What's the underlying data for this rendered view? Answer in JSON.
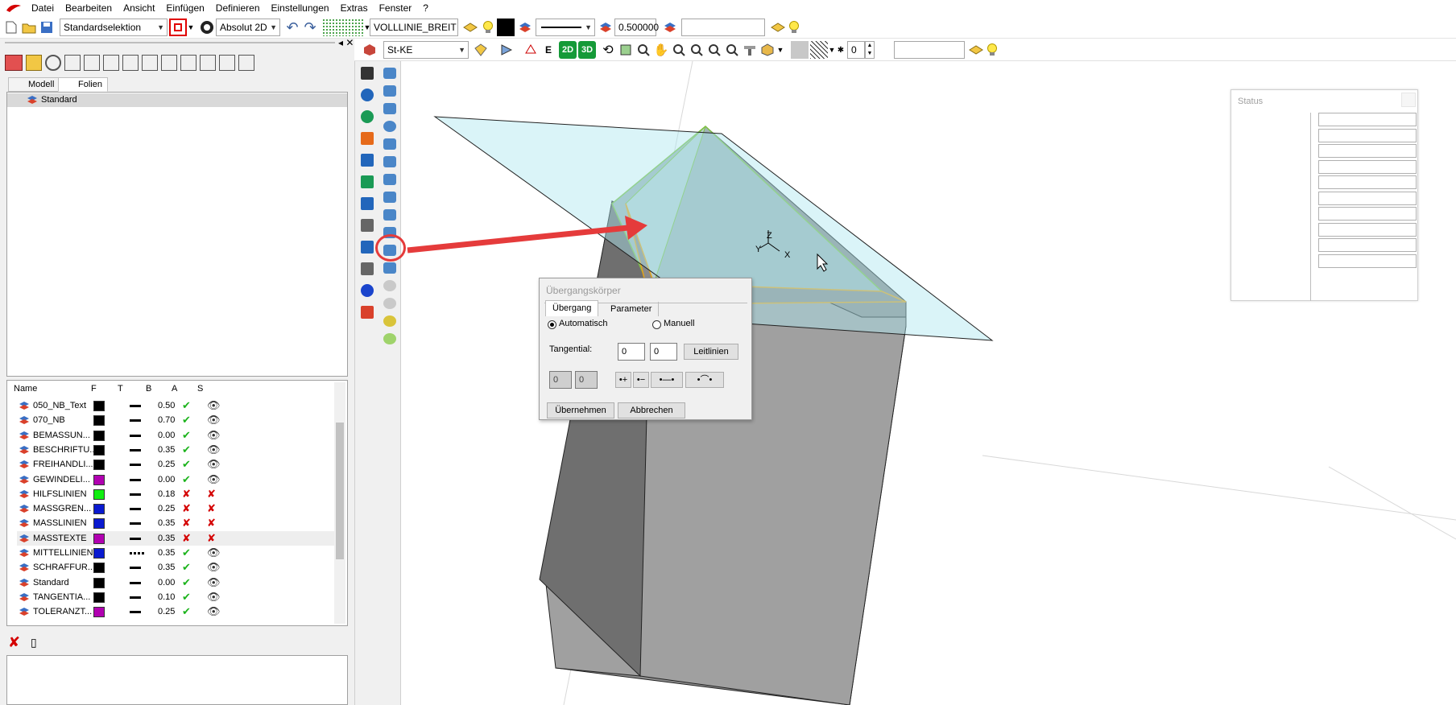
{
  "menu": [
    "Datei",
    "Bearbeiten",
    "Ansicht",
    "Einfügen",
    "Definieren",
    "Einstellungen",
    "Extras",
    "Fenster",
    "?"
  ],
  "toolbar1": {
    "selection_combo": "Standardselektion",
    "view_combo": "Absolut 2D",
    "linetype_field": "VOLLLINIE_BREIT",
    "width_field": "0.500000",
    "colors": {
      "red": "#e00000",
      "black": "#000000"
    }
  },
  "toolbar2": {
    "material_combo": "St-KE",
    "btn_2d": "2D",
    "btn_3d": "3D",
    "spin_value": "0"
  },
  "left": {
    "tabs": {
      "modell": "Modell",
      "folien": "Folien"
    },
    "tree_item": "Standard",
    "headers": {
      "name": "Name",
      "f": "F",
      "t": "T",
      "b": "B",
      "a": "A",
      "s": "S"
    },
    "layers": [
      {
        "name": "050_NB_Text",
        "color": "#000000",
        "b": "0.50",
        "a": "✔",
        "s": "👁",
        "line": "solid"
      },
      {
        "name": "070_NB",
        "color": "#000000",
        "b": "0.70",
        "a": "✔",
        "s": "👁",
        "line": "solid"
      },
      {
        "name": "BEMASSUN...",
        "color": "#000000",
        "b": "0.00",
        "a": "✔",
        "s": "👁",
        "line": "solid"
      },
      {
        "name": "BESCHRIFTU...",
        "color": "#000000",
        "b": "0.35",
        "a": "✔",
        "s": "👁",
        "line": "solid"
      },
      {
        "name": "FREIHANDLI...",
        "color": "#000000",
        "b": "0.25",
        "a": "✔",
        "s": "👁",
        "line": "solid"
      },
      {
        "name": "GEWINDELI...",
        "color": "#b100b1",
        "b": "0.00",
        "a": "✔",
        "s": "👁",
        "line": "solid"
      },
      {
        "name": "HILFSLINIEN",
        "color": "#11ee11",
        "b": "0.18",
        "a": "✘",
        "s": "✘",
        "line": "solid"
      },
      {
        "name": "MASSGREN...",
        "color": "#0a1ad0",
        "b": "0.25",
        "a": "✘",
        "s": "✘",
        "line": "solid"
      },
      {
        "name": "MASSLINIEN",
        "color": "#0a1ad0",
        "b": "0.35",
        "a": "✘",
        "s": "✘",
        "line": "solid"
      },
      {
        "name": "MASSTEXTE",
        "color": "#b100b1",
        "b": "0.35",
        "a": "✘",
        "s": "✘",
        "line": "solid"
      },
      {
        "name": "MITTELLINIEN",
        "color": "#0a1ad0",
        "b": "0.35",
        "a": "✔",
        "s": "👁",
        "line": "dash"
      },
      {
        "name": "SCHRAFFUR...",
        "color": "#000000",
        "b": "0.35",
        "a": "✔",
        "s": "👁",
        "line": "solid"
      },
      {
        "name": "Standard",
        "color": "#000000",
        "b": "0.00",
        "a": "✔",
        "s": "👁",
        "line": "solid"
      },
      {
        "name": "TANGENTIA...",
        "color": "#000000",
        "b": "0.10",
        "a": "✔",
        "s": "👁",
        "line": "solid"
      },
      {
        "name": "TOLERANZT...",
        "color": "#b100b1",
        "b": "0.25",
        "a": "✔",
        "s": "👁",
        "line": "solid"
      }
    ]
  },
  "dialog": {
    "title": "Übergangskörper",
    "tab_uebergang": "Übergang",
    "tab_parameter": "Parameter",
    "radio_auto": "Automatisch",
    "radio_manual": "Manuell",
    "tangential_label": "Tangential:",
    "tangential_a": "0",
    "tangential_b": "0",
    "leitlinien": "Leitlinien",
    "small_a": "0",
    "small_b": "0",
    "ok": "Übernehmen",
    "cancel": "Abbrechen"
  },
  "status": {
    "title": "Status"
  },
  "axis": {
    "x": "X",
    "y": "Y",
    "z": "Z"
  }
}
